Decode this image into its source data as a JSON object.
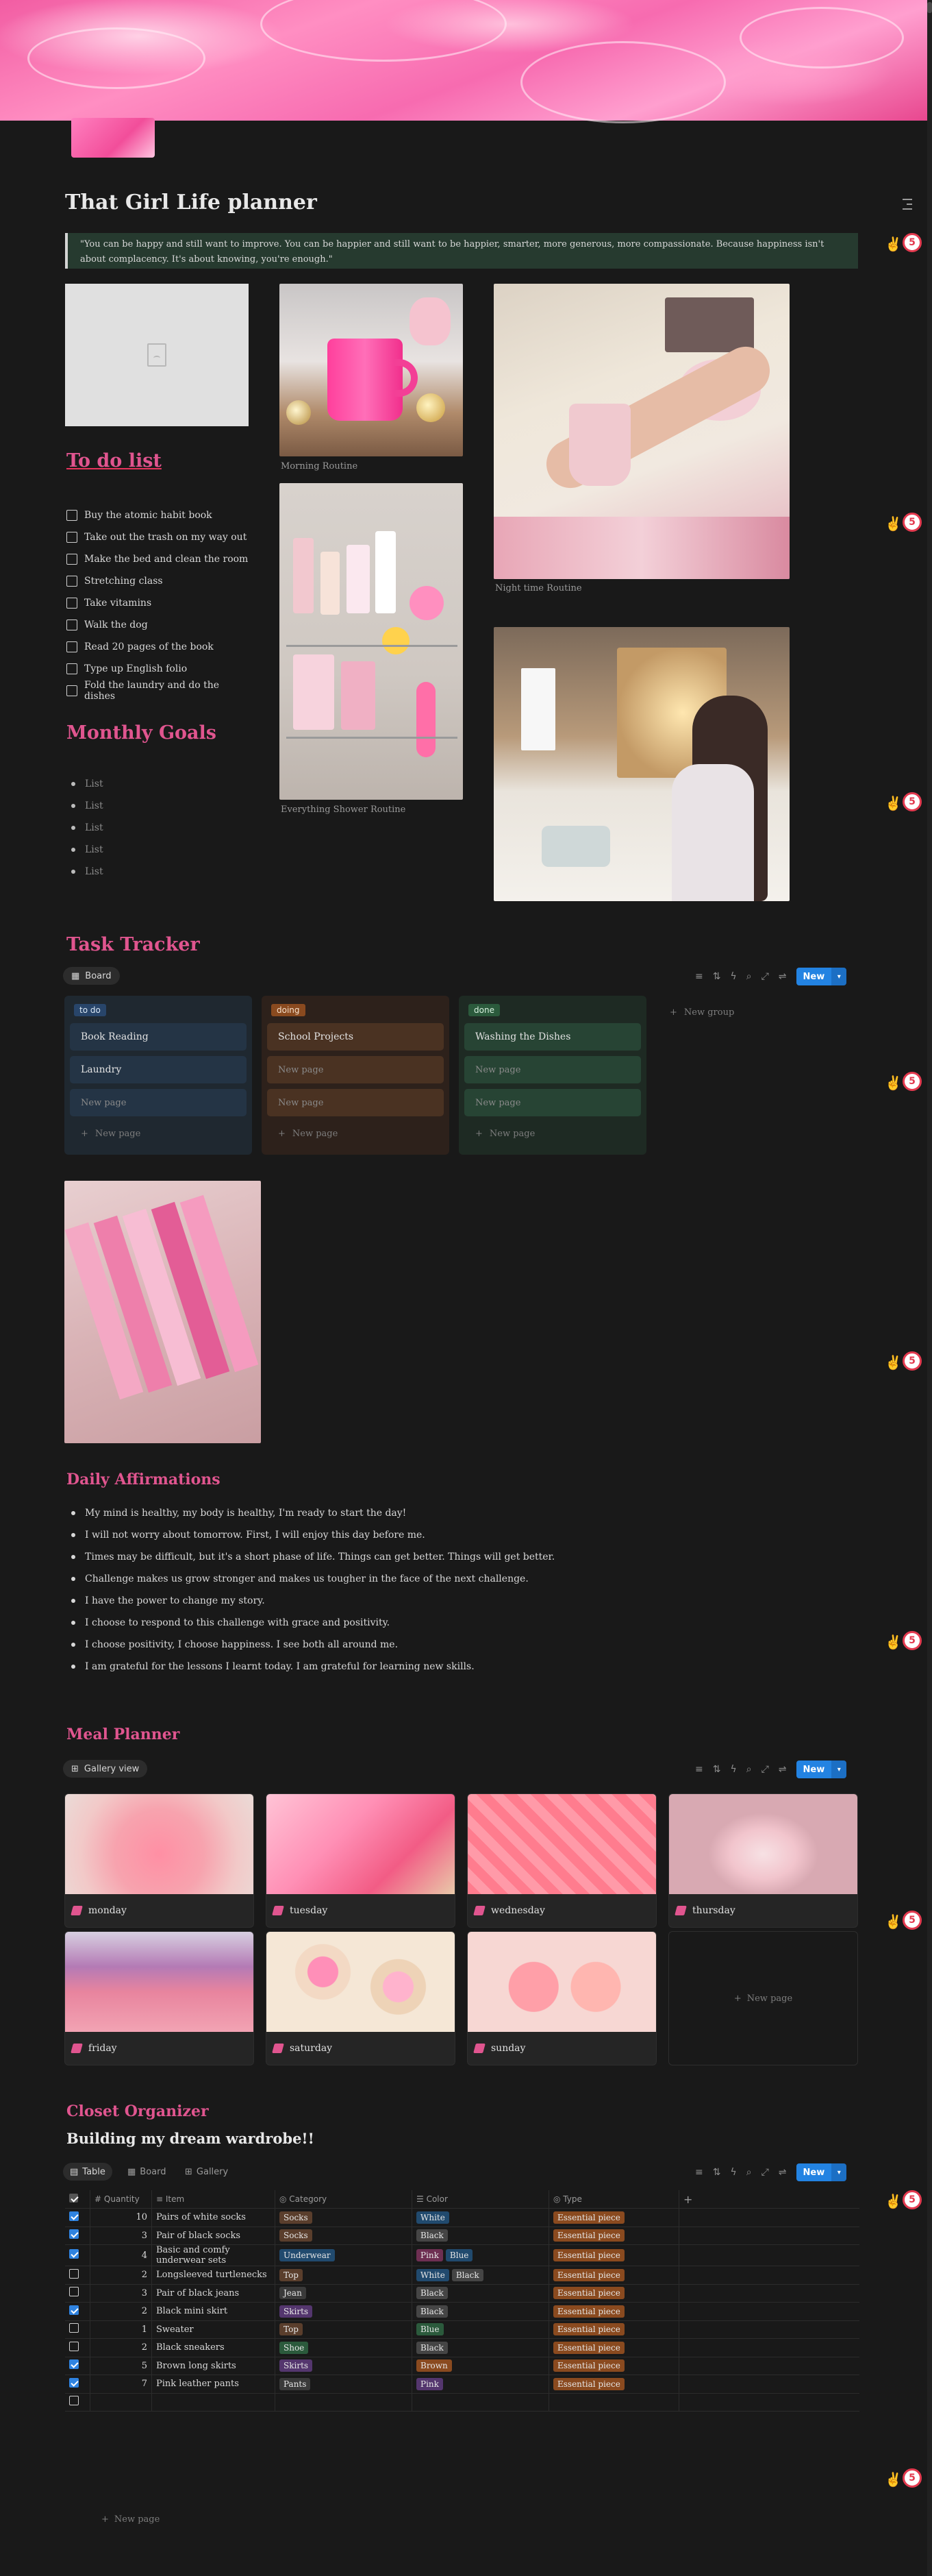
{
  "page": {
    "title": "That Girl Life planner",
    "quote": "\"You can be happy and still want to improve. You can be happier and still want to be happier, smarter, more generous, more compassionate. Because happiness isn't about complacency. It's about knowing, you're enough.\""
  },
  "todo": {
    "heading": "To do list",
    "items": [
      {
        "label": "Buy the atomic habit book",
        "checked": false
      },
      {
        "label": "Take out the trash on my way out",
        "checked": false
      },
      {
        "label": "Make the bed and clean the room",
        "checked": false
      },
      {
        "label": "Stretching class",
        "checked": false
      },
      {
        "label": "Take  vitamins",
        "checked": false
      },
      {
        "label": "Walk the dog",
        "checked": false
      },
      {
        "label": "Read 20 pages of the book",
        "checked": false
      },
      {
        "label": "Type up English folio",
        "checked": false
      },
      {
        "label": "Fold the laundry and do the dishes",
        "checked": false
      }
    ]
  },
  "goals": {
    "heading": "Monthly Goals",
    "items": [
      "List",
      "List",
      "List",
      "List",
      "List"
    ]
  },
  "gallery_captions": {
    "morning": "Morning Routine",
    "shower": "Everything Shower Routine",
    "night": "Night time Routine"
  },
  "task_tracker": {
    "heading": "Task Tracker",
    "view_label": "Board",
    "new_label": "New",
    "new_group": "New group",
    "columns": [
      {
        "name": "to do",
        "cards": [
          "Book Reading",
          "Laundry"
        ],
        "placeholder": "New page",
        "new_label": "New page"
      },
      {
        "name": "doing",
        "cards": [
          "School Projects"
        ],
        "placeholder": "New page",
        "new_label": "New page"
      },
      {
        "name": "done",
        "cards": [
          "Washing the Dishes"
        ],
        "placeholder": "New page",
        "new_label": "New page"
      }
    ]
  },
  "affirmations": {
    "heading": "Daily Affirmations",
    "items": [
      "My mind is healthy, my body is healthy, I'm ready to start the day!",
      "I will not worry about tomorrow. First, I  will enjoy this day before me.",
      "Times may be difficult, but it's a short phase of life. Things can get better. Things will get better.",
      "Challenge makes us grow stronger and makes us tougher in the face of the next challenge.",
      "I have the power to change my story.",
      "I choose to respond to this challenge with grace and positivity.",
      "I choose positivity, I choose happiness. I see both all around me.",
      "I am grateful for the lessons I learnt today. I am grateful for learning new skills."
    ]
  },
  "meal_planner": {
    "heading": "Meal Planner",
    "view_label": "Gallery view",
    "new_label": "New",
    "new_page": "New page",
    "days": [
      "monday",
      "tuesday",
      "wednesday",
      "thursday",
      "friday",
      "saturday",
      "sunday"
    ]
  },
  "closet": {
    "heading": "Closet Organizer",
    "subheading": "Building my dream wardrobe!!",
    "tabs": [
      "Table",
      "Board",
      "Gallery"
    ],
    "new_label": "New",
    "new_page": "New page",
    "columns": [
      "Quantity",
      "Item",
      "Category",
      "Color",
      "Type"
    ],
    "rows": [
      {
        "checked": true,
        "qty": "10",
        "item": "Pairs of white socks",
        "category": "Socks",
        "cat_color": "brown",
        "colors": [
          [
            "White",
            "blue"
          ]
        ],
        "type": "Essential piece"
      },
      {
        "checked": true,
        "qty": "3",
        "item": "Pair of black socks",
        "category": "Socks",
        "cat_color": "brown",
        "colors": [
          [
            "Black",
            "gray"
          ]
        ],
        "type": "Essential piece"
      },
      {
        "checked": true,
        "qty": "4",
        "item": "Basic and comfy underwear sets",
        "category": "Underwear",
        "cat_color": "blue",
        "colors": [
          [
            "Pink",
            "pink"
          ],
          [
            "Blue",
            "blue"
          ]
        ],
        "type": "Essential piece"
      },
      {
        "checked": false,
        "qty": "2",
        "item": "Longsleeved turtlenecks",
        "category": "Top",
        "cat_color": "brown",
        "colors": [
          [
            "White",
            "blue"
          ],
          [
            "Black",
            "gray"
          ]
        ],
        "type": "Essential piece"
      },
      {
        "checked": false,
        "qty": "3",
        "item": "Pair of black jeans",
        "category": "Jean",
        "cat_color": "default",
        "colors": [
          [
            "Black",
            "gray"
          ]
        ],
        "type": "Essential piece"
      },
      {
        "checked": true,
        "qty": "2",
        "item": "Black mini skirt",
        "category": "Skirts",
        "cat_color": "purple",
        "colors": [
          [
            "Black",
            "gray"
          ]
        ],
        "type": "Essential piece"
      },
      {
        "checked": false,
        "qty": "1",
        "item": "Sweater",
        "category": "Top",
        "cat_color": "brown",
        "colors": [
          [
            "Blue",
            "green"
          ]
        ],
        "type": "Essential piece"
      },
      {
        "checked": false,
        "qty": "2",
        "item": "Black sneakers",
        "category": "Shoe",
        "cat_color": "green",
        "colors": [
          [
            "Black",
            "gray"
          ]
        ],
        "type": "Essential piece"
      },
      {
        "checked": true,
        "qty": "5",
        "item": "Brown long skirts",
        "category": "Skirts",
        "cat_color": "purple",
        "colors": [
          [
            "Brown",
            "orange"
          ]
        ],
        "type": "Essential piece"
      },
      {
        "checked": true,
        "qty": "7",
        "item": "Pink leather pants",
        "category": "Pants",
        "cat_color": "default",
        "colors": [
          [
            "Pink",
            "purple"
          ]
        ],
        "type": "Essential piece"
      },
      {
        "checked": false,
        "qty": "",
        "item": "",
        "category": "",
        "cat_color": "",
        "colors": [],
        "type": ""
      }
    ]
  },
  "side_badge": "5",
  "colors": {
    "accent": "#e0558f",
    "primary": "#2383e2",
    "background": "#191919"
  }
}
